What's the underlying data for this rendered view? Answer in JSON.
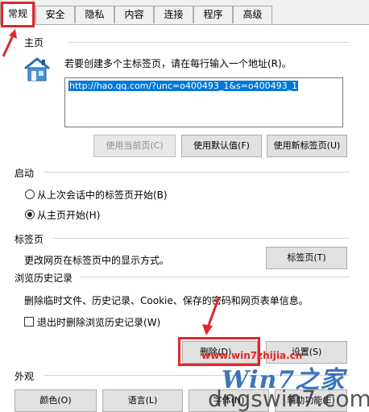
{
  "tabs": [
    {
      "label": "常规"
    },
    {
      "label": "安全"
    },
    {
      "label": "隐私"
    },
    {
      "label": "内容"
    },
    {
      "label": "连接"
    },
    {
      "label": "程序"
    },
    {
      "label": "高级"
    }
  ],
  "home": {
    "title": "主页",
    "description": "若要创建多个主标签页，请在每行输入一个地址(R)。",
    "url": "http://hao.qq.com/?unc=o400493_1&s=o400493_1",
    "buttons": {
      "use_current": "使用当前页(C)",
      "use_default": "使用默认值(F)",
      "use_new_tab": "使用新标签页(U)"
    }
  },
  "startup": {
    "title": "启动",
    "option_last_session": "从上次会话中的标签页开始(B)",
    "option_home": "从主页开始(H)"
  },
  "tabs_section": {
    "title": "标签页",
    "description": "更改网页在标签页中的显示方式。",
    "button": "标签页(T)"
  },
  "history": {
    "title": "浏览历史记录",
    "description": "删除临时文件、历史记录、Cookie、保存的密码和网页表单信息。",
    "checkbox_label": "退出时删除浏览历史记录(W)",
    "delete_button": "删除(D)...",
    "settings_button": "设置(S)"
  },
  "appearance": {
    "title": "外观",
    "buttons": {
      "colors": "颜色(O)",
      "languages": "语言(L)",
      "fonts": "字体(N)",
      "accessibility": "辅助功能(E)"
    }
  },
  "watermark": {
    "site": "www.win7zhijia.cn",
    "logo": "Win7之家",
    "domain": "dngswin7.com"
  },
  "colors": {
    "highlight": "#e3262a",
    "selection": "#0078d7"
  }
}
